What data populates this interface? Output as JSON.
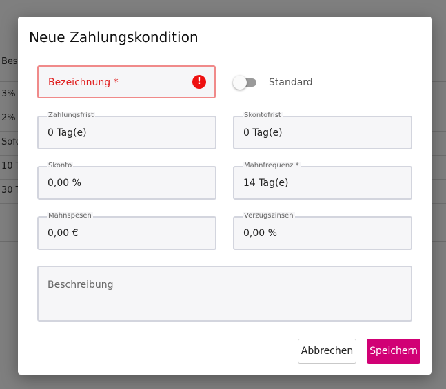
{
  "background_table": {
    "header": "Bes",
    "rows": [
      "3%",
      "2%",
      "Sofo",
      "10 T",
      "30 T"
    ]
  },
  "dialog": {
    "title": "Neue Zahlungskondition",
    "bezeichnung": {
      "placeholder": "Bezeichnung *",
      "error_icon": "!"
    },
    "standard_toggle": {
      "label": "Standard",
      "checked": false
    },
    "zahlungsfrist": {
      "label": "Zahlungsfrist",
      "value": "0 Tag(e)"
    },
    "skontofrist": {
      "label": "Skontofrist",
      "value": "0 Tag(e)"
    },
    "skonto": {
      "label": "Skonto",
      "value": "0,00 %"
    },
    "mahnfrequenz": {
      "label": "Mahnfrequenz *",
      "value": "14 Tag(e)"
    },
    "mahnspesen": {
      "label": "Mahnspesen",
      "value": "0,00 €"
    },
    "verzugszinsen": {
      "label": "Verzugszinsen",
      "value": "0,00 %"
    },
    "beschreibung": {
      "placeholder": "Beschreibung"
    },
    "buttons": {
      "cancel": "Abbrechen",
      "save": "Speichern"
    }
  },
  "colors": {
    "accent": "#d10075",
    "error": "#ee1111",
    "overlay": "rgba(0,0,0,0.5)"
  }
}
